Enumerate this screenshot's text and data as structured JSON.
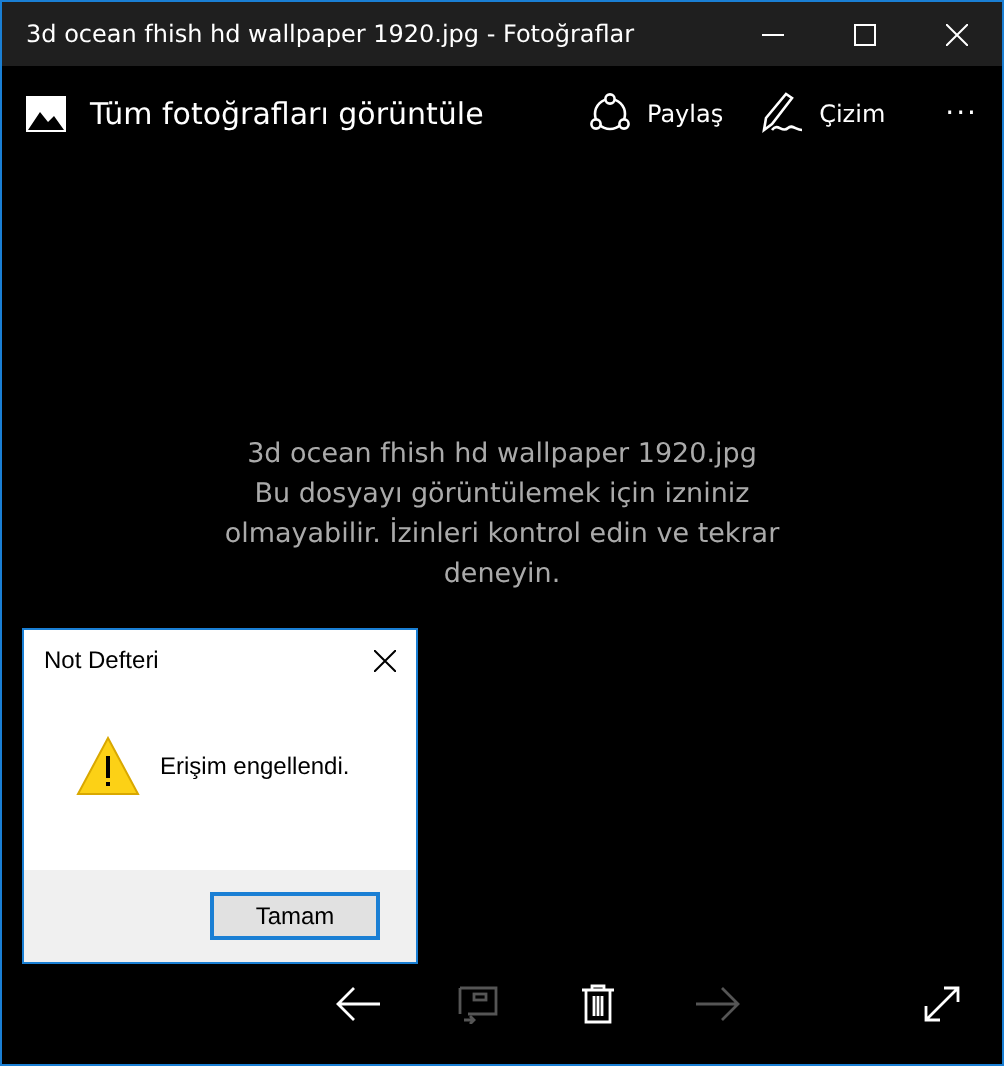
{
  "window": {
    "title": "3d ocean fhish hd wallpaper 1920.jpg - Fotoğraflar"
  },
  "toolbar": {
    "all_photos": "Tüm fotoğrafları görüntüle",
    "actions": [
      {
        "kind": "share",
        "label": "Paylaş"
      },
      {
        "kind": "draw",
        "label": "Çizim"
      }
    ],
    "more": "···"
  },
  "message": {
    "lines": [
      "3d ocean fhish hd wallpaper 1920.jpg",
      "Bu dosyayı görüntülemek için izniniz olmayabilir. İzinleri kontrol edin ve tekrar deneyin."
    ]
  },
  "bottom_bar": [
    {
      "kind": "back",
      "disabled": false
    },
    {
      "kind": "slideshow",
      "disabled": true
    },
    {
      "kind": "delete",
      "disabled": false
    },
    {
      "kind": "forward",
      "disabled": true
    },
    {
      "kind": "fullscreen",
      "disabled": false
    }
  ],
  "dialog": {
    "title": "Not Defteri",
    "message": "Erişim engellendi.",
    "button": "Tamam"
  }
}
